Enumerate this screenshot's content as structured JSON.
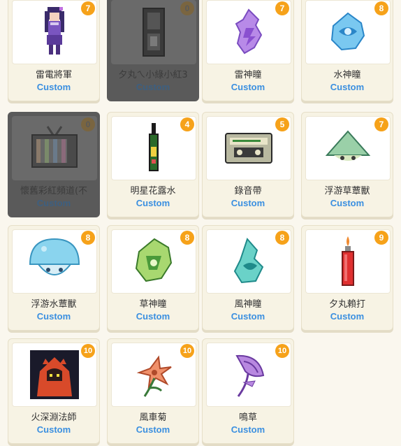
{
  "items": [
    {
      "name": "雷電將軍",
      "tag": "Custom",
      "count": "7",
      "locked": false,
      "icon": "raiden-shogun-icon"
    },
    {
      "name": "夕丸ㄟ小綠小紅3",
      "tag": "Custom",
      "count": "0",
      "locked": true,
      "icon": "traffic-light-icon"
    },
    {
      "name": "雷神瞳",
      "tag": "Custom",
      "count": "7",
      "locked": false,
      "icon": "electro-oculus-icon"
    },
    {
      "name": "水神瞳",
      "tag": "Custom",
      "count": "8",
      "locked": false,
      "icon": "hydro-oculus-icon"
    },
    {
      "name": "懷舊彩紅頻道(不",
      "tag": "Custom",
      "count": "0",
      "locked": true,
      "icon": "retro-tv-icon"
    },
    {
      "name": "明星花露水",
      "tag": "Custom",
      "count": "4",
      "locked": false,
      "icon": "perfume-bottle-icon"
    },
    {
      "name": "錄音帶",
      "tag": "Custom",
      "count": "5",
      "locked": false,
      "icon": "cassette-tape-icon"
    },
    {
      "name": "浮游草蕈獸",
      "tag": "Custom",
      "count": "7",
      "locked": false,
      "icon": "grass-fungus-icon"
    },
    {
      "name": "浮游水蕈獸",
      "tag": "Custom",
      "count": "8",
      "locked": false,
      "icon": "water-fungus-icon"
    },
    {
      "name": "草神瞳",
      "tag": "Custom",
      "count": "8",
      "locked": false,
      "icon": "dendro-oculus-icon"
    },
    {
      "name": "風神瞳",
      "tag": "Custom",
      "count": "8",
      "locked": false,
      "icon": "anemo-oculus-icon"
    },
    {
      "name": "夕丸賴打",
      "tag": "Custom",
      "count": "9",
      "locked": false,
      "icon": "lighter-icon"
    },
    {
      "name": "火深淵法師",
      "tag": "Custom",
      "count": "10",
      "locked": false,
      "icon": "pyro-abyss-mage-icon"
    },
    {
      "name": "風車菊",
      "tag": "Custom",
      "count": "10",
      "locked": false,
      "icon": "windwheel-aster-icon"
    },
    {
      "name": "鳴草",
      "tag": "Custom",
      "count": "10",
      "locked": false,
      "icon": "naku-weed-icon"
    }
  ]
}
